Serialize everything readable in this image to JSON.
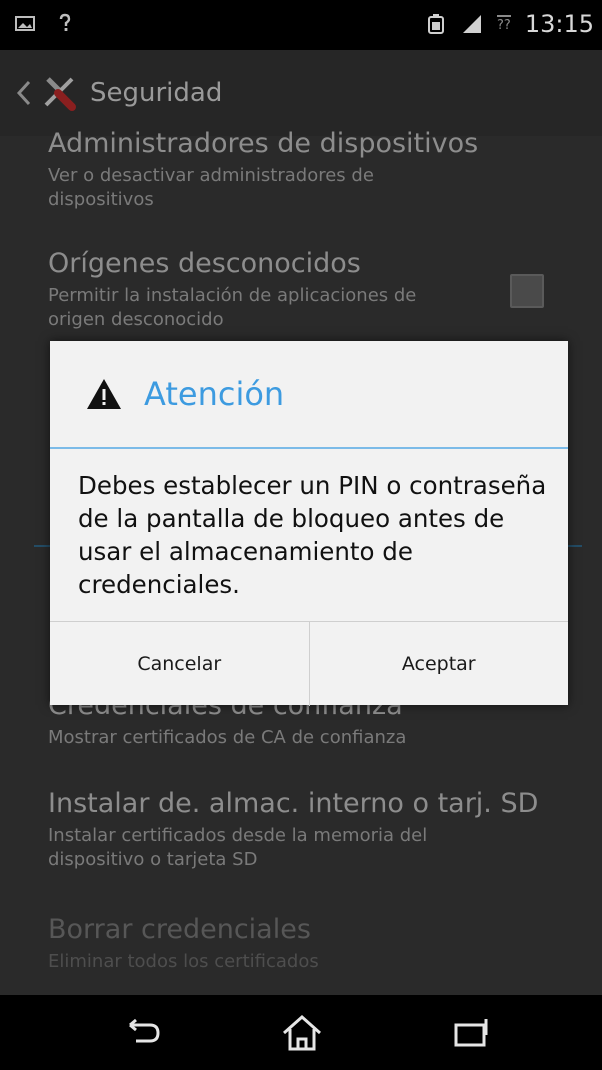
{
  "status_bar": {
    "time": "13:15",
    "icons": [
      "gallery-icon",
      "wifi-question-icon",
      "battery-icon",
      "signal-icon",
      "data-icon"
    ],
    "network_label": "??"
  },
  "action_bar": {
    "title": "Seguridad",
    "back_icon": "chevron-left-icon",
    "app_icon": "settings-tools-icon"
  },
  "settings": {
    "device_admins": {
      "title": "Administradores de dispositivos",
      "summary": "Ver o desactivar administradores de dispositivos"
    },
    "unknown_sources": {
      "title": "Orígenes desconocidos",
      "summary": "Permitir la instalación de aplicaciones de origen desconocido",
      "checked": false
    },
    "trusted_credentials": {
      "title": "Credenciales de confianza",
      "summary": "Mostrar certificados de CA de confianza"
    },
    "install_from_storage": {
      "title": "Instalar de. almac. interno o tarj. SD",
      "summary": "Instalar certificados desde la memoria del dispositivo o tarjeta SD"
    },
    "clear_credentials": {
      "title": "Borrar credenciales",
      "summary": "Eliminar todos los certificados",
      "enabled": false
    }
  },
  "dialog": {
    "title": "Atención",
    "icon": "warning-icon",
    "message": "Debes establecer un PIN o contraseña de la pantalla de bloqueo antes de usar el almacenamiento de credenciales.",
    "cancel_label": "Cancelar",
    "accept_label": "Aceptar"
  },
  "nav_bar": {
    "icons": [
      "back-icon",
      "home-icon",
      "recents-icon"
    ]
  },
  "colors": {
    "accent": "#3d9be0",
    "dialog_background": "#f2f2f2",
    "screen_background": "#2a2a2a"
  }
}
